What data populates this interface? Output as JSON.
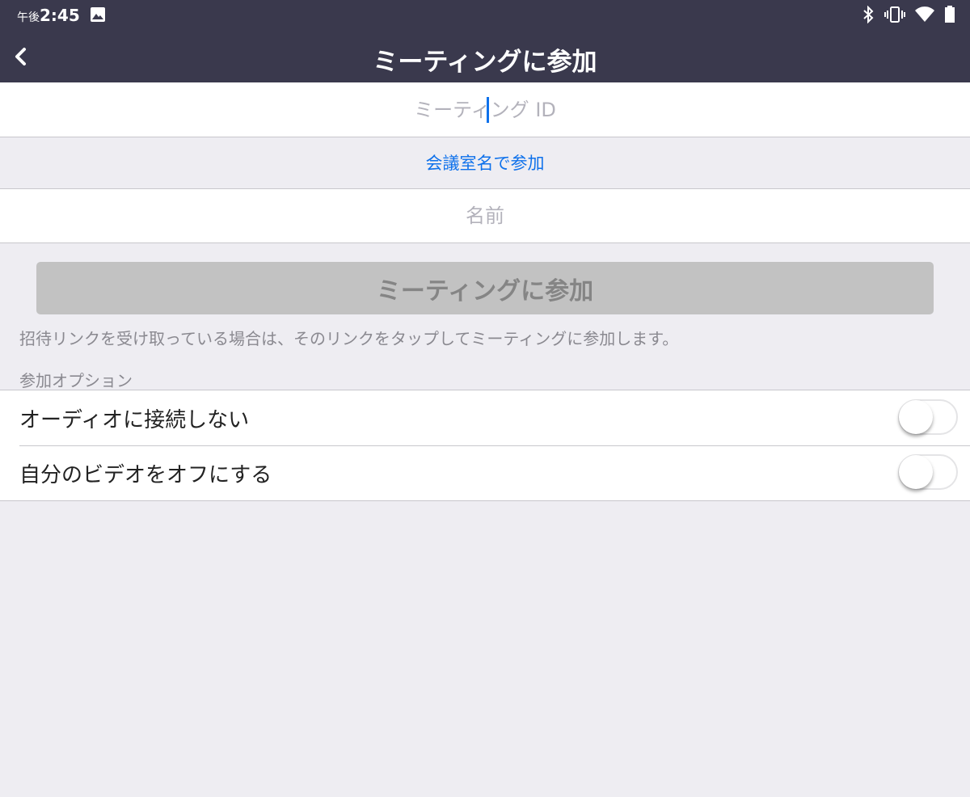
{
  "status_bar": {
    "ampm": "午後",
    "time": "2:45",
    "icons": [
      "image-icon",
      "bluetooth-icon",
      "vibrate-icon",
      "wifi-icon",
      "battery-icon"
    ]
  },
  "nav": {
    "back_icon": "chevron-left-icon",
    "title": "ミーティングに参加"
  },
  "meeting_id": {
    "placeholder": "ミーティング ID",
    "value": ""
  },
  "room_link": "会議室名で参加",
  "name_field": {
    "placeholder": "名前",
    "value": ""
  },
  "join_button": "ミーティングに参加",
  "hint": "招待リンクを受け取っている場合は、そのリンクをタップしてミーティングに参加します。",
  "options_label": "参加オプション",
  "options": [
    {
      "label": "オーディオに接続しない",
      "on": false
    },
    {
      "label": "自分のビデオをオフにする",
      "on": false
    }
  ],
  "colors": {
    "header": "#3a394d",
    "accent": "#0e71eb",
    "background": "#eeedf2",
    "button_disabled": "#c2c2c2"
  }
}
